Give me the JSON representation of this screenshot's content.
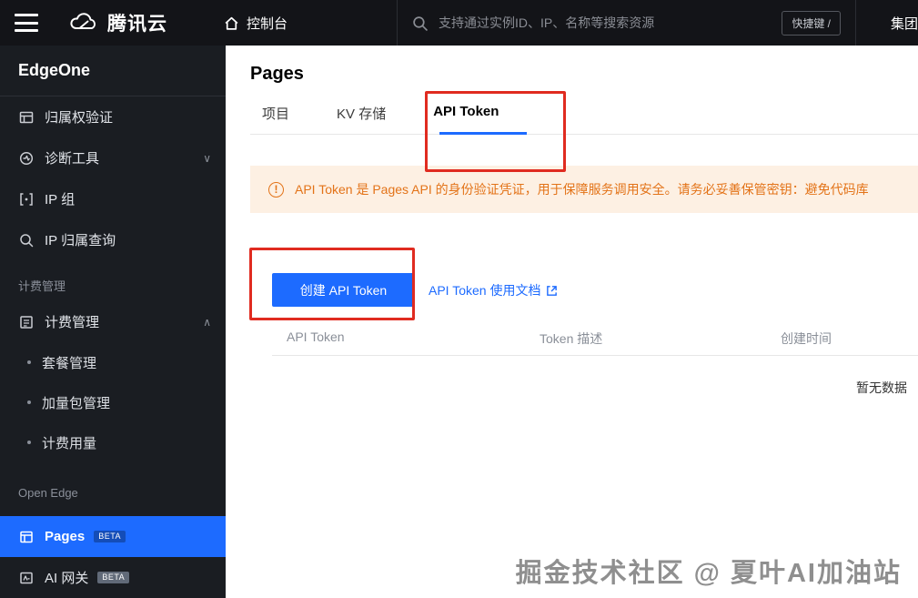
{
  "topbar": {
    "brand": "腾讯云",
    "console_label": "控制台",
    "search_placeholder": "支持通过实例ID、IP、名称等搜索资源",
    "shortcut_label": "快捷键 /",
    "group_label": "集团"
  },
  "sidebar": {
    "product_title": "EdgeOne",
    "items": [
      {
        "label": "归属权验证"
      },
      {
        "label": "诊断工具"
      },
      {
        "label": "IP 组"
      },
      {
        "label": "IP 归属查询"
      }
    ],
    "section_billing": "计费管理",
    "billing_item": "计费管理",
    "billing_children": [
      {
        "label": "套餐管理"
      },
      {
        "label": "加量包管理"
      },
      {
        "label": "计费用量"
      }
    ],
    "section_openedge": "Open Edge",
    "pages_item": {
      "label": "Pages",
      "badge": "BETA"
    },
    "ai_gateway_item": {
      "label": "AI 网关",
      "badge": "BETA"
    }
  },
  "main": {
    "page_title": "Pages",
    "tabs": [
      {
        "label": "项目"
      },
      {
        "label": "KV 存储"
      },
      {
        "label": "API Token"
      }
    ],
    "banner_text": "API Token 是 Pages API 的身份验证凭证，用于保障服务调用安全。请务必妥善保管密钥：避免代码库",
    "create_button_label": "创建 API Token",
    "doc_link_label": "API Token 使用文档",
    "table_headers": [
      "API Token",
      "Token 描述",
      "创建时间"
    ],
    "empty_text": "暂无数据",
    "watermark": "掘金技术社区 @ 夏叶AI加油站"
  },
  "colors": {
    "accent_blue": "#1d6bff",
    "warning_orange": "#e37318",
    "annotation_red": "#e02b20"
  }
}
